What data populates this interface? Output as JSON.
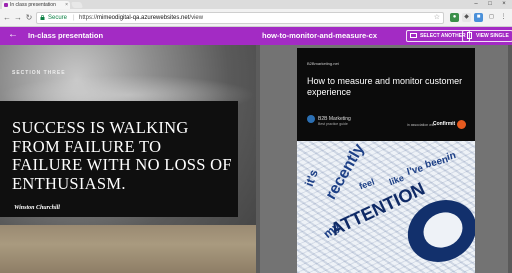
{
  "browser": {
    "tab_title": "In class presentation",
    "tab_close": "×",
    "window_controls": [
      "–",
      "□",
      "×"
    ],
    "nav": {
      "back": "←",
      "forward": "→",
      "reload": "↻"
    },
    "secure_label": "Secure",
    "url_scheme": "https://",
    "url_host": "mimeodigital-qa.azurewebsites.net",
    "url_path": "/view",
    "star": "☆"
  },
  "header": {
    "back_icon": "←",
    "app_title": "In-class presentation",
    "doc_title": "how-to-monitor-and-measure-cx",
    "select_another": "SELECT ANOTHER",
    "view_single": "VIEW SINGLE",
    "color": "#a32bc4"
  },
  "left_slide": {
    "section_label": "SECTION THREE",
    "quote": "SUCCESS IS WALKING FROM FAILURE TO FAILURE WITH NO LOSS OF ENTHUSIASM.",
    "author": "Winston Churchill"
  },
  "right_doc": {
    "brand": "B2Bmarketing.net",
    "title": "How to measure and monitor customer experience",
    "b2b_label": "B2B Marketing",
    "b2b_sub": "Best practice guide",
    "sponsor_label": "in association with",
    "sponsor": "Confirmit",
    "art_words": [
      "it's",
      "recently",
      "my",
      "ATTENTION",
      "feel",
      "like",
      "I've",
      "been",
      "in"
    ]
  }
}
